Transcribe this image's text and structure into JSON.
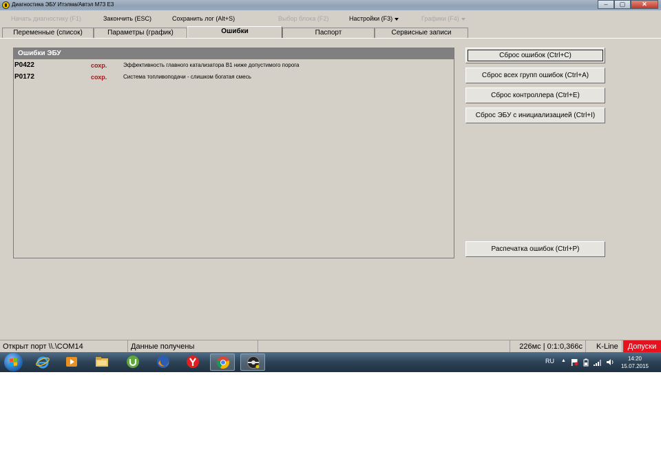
{
  "window": {
    "title": "Диагностика ЭБУ Итэлма/Автэл М73 Е3",
    "buttons": [
      "minimize",
      "maximize",
      "close"
    ]
  },
  "menu": {
    "start_diag": "Начать диагностику (F1)",
    "finish": "Закончить (ESC)",
    "save_log": "Сохранить лог (Alt+S)",
    "select_block": "Выбор блока (F2)",
    "settings": "Настройки (F3)",
    "graphs": "Графики (F4)"
  },
  "tabs": [
    {
      "label": "Переменные (список)"
    },
    {
      "label": "Параметры (график)"
    },
    {
      "label": "Ошибки"
    },
    {
      "label": "Паспорт"
    },
    {
      "label": "Сервисные записи"
    }
  ],
  "errors_panel": {
    "title": "Ошибки ЭБУ",
    "rows": [
      {
        "code": "P0422",
        "status": "сохр.",
        "description": "Эффективность главного катализатора B1 ниже допустимого порога"
      },
      {
        "code": "P0172",
        "status": "сохр.",
        "description": "Система топливоподачи - слишком богатая  смесь"
      }
    ]
  },
  "buttons": {
    "reset_errors": "Сброс ошибок (Ctrl+C)",
    "reset_all_groups": "Сброс всех групп ошибок (Ctrl+A)",
    "reset_controller": "Сброс контроллера (Ctrl+E)",
    "reset_ecu_init": "Сброс ЭБУ с инициализацией (Ctrl+I)",
    "print_errors": "Распечатка ошибок (Ctrl+P)"
  },
  "status": {
    "port": "Открыт порт \\\\.\\COM14",
    "data": "Данные получены",
    "timing": "226мс | 0:1:0,366с",
    "protocol": "K-Line",
    "alert": "Допуски"
  },
  "taskbar": {
    "icons": [
      "windows-start",
      "internet-explorer",
      "media-player",
      "file-explorer",
      "utorrent",
      "firefox",
      "yandex-browser",
      "chrome",
      "diagnostic-app"
    ],
    "language": "RU",
    "time": "14:20",
    "date": "15.07.2015"
  },
  "colors": {
    "window_bg": "#d4d0c8",
    "panel_header": "#808080",
    "status_code_red": "#a01818",
    "alert_red": "#e8121e"
  }
}
